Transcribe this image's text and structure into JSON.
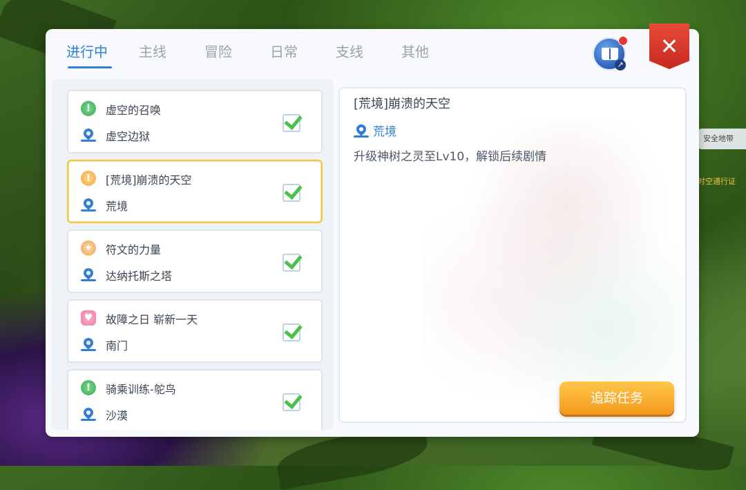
{
  "tabs": [
    {
      "label": "进行中",
      "active": true
    },
    {
      "label": "主线",
      "active": false
    },
    {
      "label": "冒险",
      "active": false
    },
    {
      "label": "日常",
      "active": false
    },
    {
      "label": "支线",
      "active": false
    },
    {
      "label": "其他",
      "active": false
    }
  ],
  "close_label": "✕",
  "side": {
    "safe_text": "安全地带",
    "pass_text": "时空通行证"
  },
  "quests": [
    {
      "title": "虚空的召唤",
      "location": "虚空边狱",
      "icon": "exclamation-icon",
      "icon_color": "#3aa858",
      "icon_glyph": "!"
    },
    {
      "title": "[荒境]崩溃的天空",
      "location": "荒境",
      "icon": "exclamation-icon",
      "icon_color": "#f2a640",
      "icon_glyph": "!"
    },
    {
      "title": "符文的力量",
      "location": "达纳托斯之塔",
      "icon": "rune-icon",
      "icon_color": "#e7a45a",
      "icon_glyph": "✦"
    },
    {
      "title": "故障之日 崭新一天",
      "location": "南门",
      "icon": "gift-icon",
      "icon_color": "#f07aa0",
      "icon_glyph": "♥"
    },
    {
      "title": "骑乘训练-鸵鸟",
      "location": "沙漠",
      "icon": "exclamation-icon",
      "icon_color": "#3aa858",
      "icon_glyph": "!"
    }
  ],
  "detail": {
    "title": "[荒境]崩溃的天空",
    "location": "荒境",
    "description": "升级神树之灵至Lv10，解锁后续剧情"
  },
  "track_button_label": "追踪任务",
  "colors": {
    "accent_blue": "#2f7fd6",
    "selected_border": "#f0c64a",
    "check_green": "#4cc04a",
    "close_red": "#d83a2c",
    "track_orange": "#f6a92a"
  }
}
